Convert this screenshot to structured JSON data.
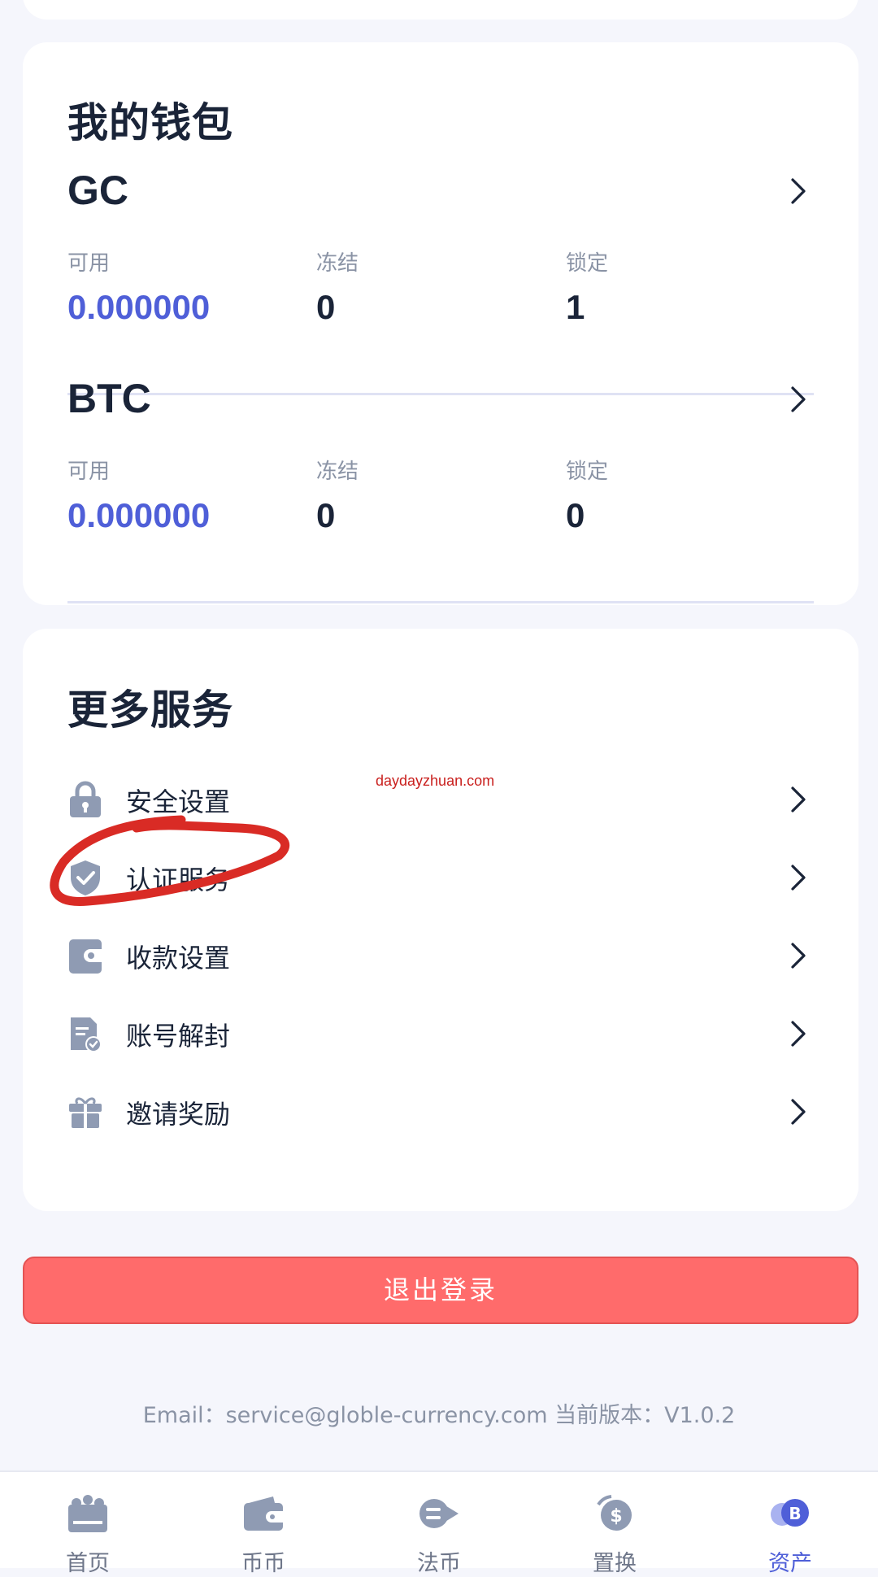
{
  "wallet": {
    "title": "我的钱包",
    "coins": [
      {
        "name": "GC",
        "available_label": "可用",
        "available": "0.000000",
        "frozen_label": "冻结",
        "frozen": "0",
        "locked_label": "锁定",
        "locked": "1"
      },
      {
        "name": "BTC",
        "available_label": "可用",
        "available": "0.000000",
        "frozen_label": "冻结",
        "frozen": "0",
        "locked_label": "锁定",
        "locked": "0"
      }
    ]
  },
  "services": {
    "title": "更多服务",
    "items": [
      {
        "label": "安全设置",
        "icon": "lock-icon"
      },
      {
        "label": "认证服务",
        "icon": "shield-check-icon"
      },
      {
        "label": "收款设置",
        "icon": "wallet-icon"
      },
      {
        "label": "账号解封",
        "icon": "document-check-icon"
      },
      {
        "label": "邀请奖励",
        "icon": "gift-icon"
      }
    ]
  },
  "watermark": "daydayzhuan.com",
  "logout_label": "退出登录",
  "footer": "Email：service@globle-currency.com 当前版本：V1.0.2",
  "tabbar": {
    "items": [
      {
        "label": "首页",
        "icon": "home-icon"
      },
      {
        "label": "币币",
        "icon": "wallet-icon"
      },
      {
        "label": "法币",
        "icon": "exchange-icon"
      },
      {
        "label": "置换",
        "icon": "swap-dollar-icon"
      },
      {
        "label": "资产",
        "icon": "bitcoin-asset-icon"
      }
    ],
    "active_index": 4
  },
  "colors": {
    "accent": "#4f5fd8",
    "logout": "#ff6b6b",
    "icon_gray": "#8f9bb3",
    "annotation_red": "#d92b25"
  }
}
